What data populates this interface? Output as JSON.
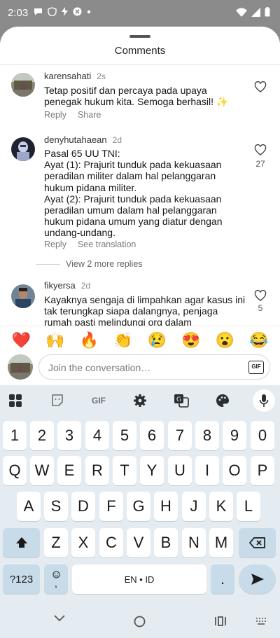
{
  "status_bar": {
    "time": "2:03"
  },
  "sheet": {
    "title": "Comments"
  },
  "comments": [
    {
      "username": "karensahati",
      "time": "2s",
      "text": "Tetap positif dan percaya pada upaya penegak hukum kita. Semoga berhasil! ✨",
      "reply_label": "Reply",
      "secondary_action": "Share",
      "likes": ""
    },
    {
      "username": "denyhutahaean",
      "time": "2d",
      "text": "Pasal 65 UU TNI:\nAyat (1): Prajurit tunduk pada kekuasaan peradilan militer dalam hal pelanggaran hukum pidana militer.\nAyat (2): Prajurit tunduk pada kekuasaan peradilan umum dalam hal pelanggaran hukum pidana umum yang diatur dengan undang-undang.",
      "reply_label": "Reply",
      "secondary_action": "See translation",
      "likes": "27"
    },
    {
      "username": "fikyersa",
      "time": "2d",
      "text": "Kayaknya sengaja di limpahkan agar kasus ini tak terungkap siapa dalangnya, penjaga rumah pasti melindungi org dalam",
      "likes": "5"
    }
  ],
  "more_replies": "View 2 more replies",
  "emoji_bar": [
    "❤️",
    "🙌",
    "🔥",
    "👏",
    "😢",
    "😍",
    "😮",
    "😂"
  ],
  "compose": {
    "placeholder": "Join the conversation…",
    "gif_label": "GIF"
  },
  "keyboard": {
    "toolbar": {
      "gif": "GIF"
    },
    "rows": {
      "numbers": [
        "1",
        "2",
        "3",
        "4",
        "5",
        "6",
        "7",
        "8",
        "9",
        "0"
      ],
      "row1": [
        "Q",
        "W",
        "E",
        "R",
        "T",
        "Y",
        "U",
        "I",
        "O",
        "P"
      ],
      "row2": [
        "A",
        "S",
        "D",
        "F",
        "G",
        "H",
        "J",
        "K",
        "L"
      ],
      "row3": [
        "Z",
        "X",
        "C",
        "V",
        "B",
        "N",
        "M"
      ]
    },
    "sym_label": "?123",
    "comma_label": ",",
    "space_label": "EN • ID",
    "period_label": "."
  },
  "colors": {
    "sheet": "#ffffff",
    "keyboard": "#e4ebf1",
    "key_dark": "#c8dbe9",
    "dim": "#8a8a8a"
  }
}
